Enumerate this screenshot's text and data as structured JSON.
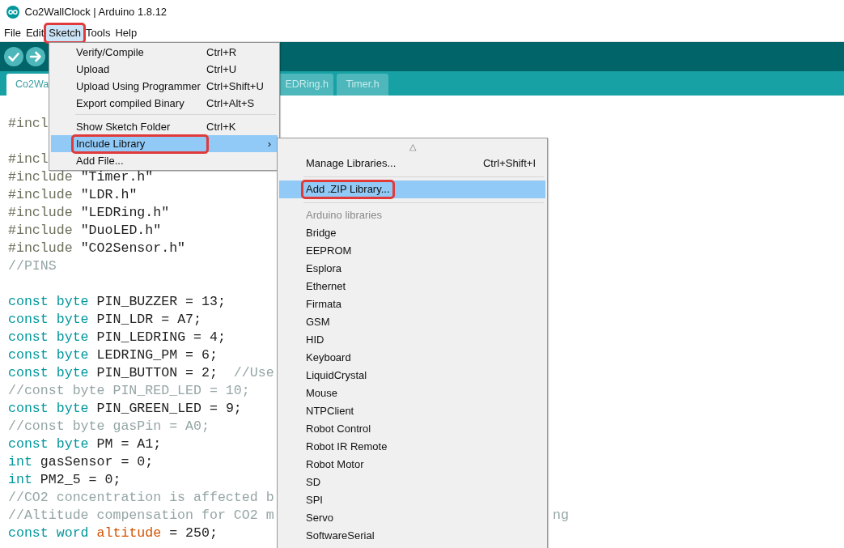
{
  "window": {
    "title": "Co2WallClock | Arduino 1.8.12"
  },
  "menubar": [
    {
      "label": "File",
      "selected": false,
      "annotated": false
    },
    {
      "label": "Edit",
      "selected": false,
      "annotated": false
    },
    {
      "label": "Sketch",
      "selected": true,
      "annotated": true
    },
    {
      "label": "Tools",
      "selected": false,
      "annotated": false
    },
    {
      "label": "Help",
      "selected": false,
      "annotated": false
    }
  ],
  "toolbar": [
    {
      "kind": "verify"
    },
    {
      "kind": "upload"
    }
  ],
  "tabs": [
    {
      "label": "Co2Wa",
      "selected": true
    },
    {
      "label": "EDRing.h",
      "selected": false
    },
    {
      "label": "Timer.h",
      "selected": false
    }
  ],
  "code": [
    {
      "segments": [
        {
          "kind": "directive",
          "text": "#incl"
        }
      ]
    },
    {
      "kind": "blank"
    },
    {
      "segments": [
        {
          "kind": "directive",
          "text": "#incl"
        }
      ]
    },
    {
      "segments": [
        {
          "kind": "directive",
          "text": "#include"
        },
        {
          "kind": "plain",
          "text": " \"Timer.h\""
        }
      ]
    },
    {
      "segments": [
        {
          "kind": "directive",
          "text": "#include"
        },
        {
          "kind": "plain",
          "text": " \"LDR.h\""
        }
      ]
    },
    {
      "segments": [
        {
          "kind": "directive",
          "text": "#include"
        },
        {
          "kind": "plain",
          "text": " \"LEDRing.h\""
        }
      ]
    },
    {
      "segments": [
        {
          "kind": "directive",
          "text": "#include"
        },
        {
          "kind": "plain",
          "text": " \"DuoLED.h\""
        }
      ]
    },
    {
      "segments": [
        {
          "kind": "directive",
          "text": "#include"
        },
        {
          "kind": "plain",
          "text": " \"CO2Sensor.h\""
        }
      ]
    },
    {
      "segments": [
        {
          "kind": "comment",
          "text": "//PINS"
        }
      ]
    },
    {
      "kind": "blank"
    },
    {
      "segments": [
        {
          "kind": "keyword",
          "text": "const byte"
        },
        {
          "kind": "plain",
          "text": " PIN_BUZZER = 13;"
        }
      ]
    },
    {
      "segments": [
        {
          "kind": "keyword",
          "text": "const byte"
        },
        {
          "kind": "plain",
          "text": " PIN_LDR = A7;"
        }
      ]
    },
    {
      "segments": [
        {
          "kind": "keyword",
          "text": "const byte"
        },
        {
          "kind": "plain",
          "text": " PIN_LEDRING = 4;"
        }
      ]
    },
    {
      "segments": [
        {
          "kind": "keyword",
          "text": "const byte"
        },
        {
          "kind": "plain",
          "text": " LEDRING_PM = 6;"
        }
      ]
    },
    {
      "segments": [
        {
          "kind": "keyword",
          "text": "const byte"
        },
        {
          "kind": "plain",
          "text": " PIN_BUTTON = 2;  "
        },
        {
          "kind": "comment",
          "text": "//Use"
        }
      ]
    },
    {
      "segments": [
        {
          "kind": "comment",
          "text": "//const byte PIN_RED_LED = 10;"
        }
      ]
    },
    {
      "segments": [
        {
          "kind": "keyword",
          "text": "const byte"
        },
        {
          "kind": "plain",
          "text": " PIN_GREEN_LED = 9;"
        }
      ]
    },
    {
      "segments": [
        {
          "kind": "comment",
          "text": "//const byte gasPin = A0;"
        }
      ]
    },
    {
      "segments": [
        {
          "kind": "keyword",
          "text": "const byte"
        },
        {
          "kind": "plain",
          "text": " PM = A1;"
        }
      ]
    },
    {
      "segments": [
        {
          "kind": "keyword",
          "text": "int"
        },
        {
          "kind": "plain",
          "text": " gasSensor = 0;"
        }
      ]
    },
    {
      "segments": [
        {
          "kind": "keyword",
          "text": "int"
        },
        {
          "kind": "plain",
          "text": " PM2_5 = 0;"
        }
      ]
    },
    {
      "segments": [
        {
          "kind": "comment",
          "text": "//CO2 concentration is affected b"
        }
      ]
    },
    {
      "segments": [
        {
          "kind": "comment",
          "text": "//Altitude compensation for CO2 m"
        }
      ],
      "tail": "ng"
    },
    {
      "segments": [
        {
          "kind": "keyword",
          "text": "const word "
        },
        {
          "kind": "variable",
          "text": "altitude"
        },
        {
          "kind": "plain",
          "text": " = 250;"
        }
      ]
    }
  ],
  "sketch_menu": [
    {
      "label": "Verify/Compile",
      "shortcut": "Ctrl+R",
      "selected": false,
      "annotated": false
    },
    {
      "label": "Upload",
      "shortcut": "Ctrl+U",
      "selected": false,
      "annotated": false
    },
    {
      "label": "Upload Using Programmer",
      "shortcut": "Ctrl+Shift+U",
      "selected": false,
      "annotated": false
    },
    {
      "label": "Export compiled Binary",
      "shortcut": "Ctrl+Alt+S",
      "selected": false,
      "annotated": false
    },
    {
      "kind": "separator"
    },
    {
      "label": "Show Sketch Folder",
      "shortcut": "Ctrl+K",
      "selected": false,
      "annotated": false
    },
    {
      "label": "Include Library",
      "submenu_arrow": "›",
      "selected": true,
      "annotated": true
    },
    {
      "label": "Add File...",
      "selected": false,
      "annotated": false
    }
  ],
  "library_menu": {
    "scroll_up": "△",
    "items": [
      {
        "kind": "action",
        "label": "Manage Libraries...",
        "shortcut": "Ctrl+Shift+I",
        "selected": false,
        "annotated": false
      },
      {
        "kind": "separator"
      },
      {
        "kind": "action",
        "label": "Add .ZIP Library...",
        "selected": true,
        "annotated": true
      },
      {
        "kind": "separator"
      },
      {
        "kind": "header",
        "label": "Arduino libraries"
      },
      {
        "kind": "library",
        "label": "Bridge",
        "selected": false
      },
      {
        "kind": "library",
        "label": "EEPROM",
        "selected": false
      },
      {
        "kind": "library",
        "label": "Esplora",
        "selected": false
      },
      {
        "kind": "library",
        "label": "Ethernet",
        "selected": false
      },
      {
        "kind": "library",
        "label": "Firmata",
        "selected": false
      },
      {
        "kind": "library",
        "label": "GSM",
        "selected": false
      },
      {
        "kind": "library",
        "label": "HID",
        "selected": false
      },
      {
        "kind": "library",
        "label": "Keyboard",
        "selected": false
      },
      {
        "kind": "library",
        "label": "LiquidCrystal",
        "selected": false
      },
      {
        "kind": "library",
        "label": "Mouse",
        "selected": false
      },
      {
        "kind": "library",
        "label": "NTPClient",
        "selected": false
      },
      {
        "kind": "library",
        "label": "Robot Control",
        "selected": false
      },
      {
        "kind": "library",
        "label": "Robot IR Remote",
        "selected": false
      },
      {
        "kind": "library",
        "label": "Robot Motor",
        "selected": false
      },
      {
        "kind": "library",
        "label": "SD",
        "selected": false
      },
      {
        "kind": "library",
        "label": "SPI",
        "selected": false
      },
      {
        "kind": "library",
        "label": "Servo",
        "selected": false
      },
      {
        "kind": "library",
        "label": "SoftwareSerial",
        "selected": false
      }
    ]
  }
}
